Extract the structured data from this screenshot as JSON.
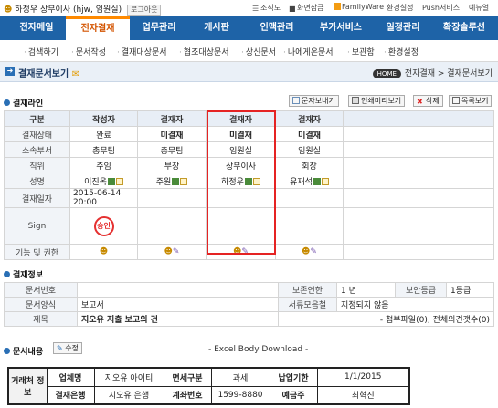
{
  "topbar": {
    "user_text": "하정우 상무이사 (hjw, 임원실)",
    "logout_label": "로그아웃",
    "util": [
      "조직도",
      "화면잠금",
      "FamilyWare",
      "환경설정",
      "Push서비스",
      "예뉴얼"
    ]
  },
  "nav": {
    "tabs": [
      "전자메일",
      "전자결재",
      "업무관리",
      "게시판",
      "인맥관리",
      "부가서비스",
      "일정관리",
      "확장솔루션"
    ],
    "active": "전자결재"
  },
  "subnav": [
    "검색하기",
    "문서작성",
    "결재대상문서",
    "협조대상문서",
    "상신문서",
    "나에게온문서",
    "보관함",
    "환경설정"
  ],
  "page": {
    "title": "결재문서보기",
    "home_label": "HOME",
    "breadcrumb": "전자결재 > 결재문서보기"
  },
  "approval": {
    "section_title": "결재라인",
    "buttons": [
      "문자보내기",
      "인쇄미리보기",
      "삭제",
      "목록보기"
    ],
    "columns": [
      "구분",
      "작성자",
      "결재자",
      "결재자",
      "결재자"
    ],
    "rows": [
      {
        "label": "결재상태",
        "cells": [
          "완료",
          "미결재",
          "미결재",
          "미결재"
        ]
      },
      {
        "label": "소속부서",
        "cells": [
          "총무팀",
          "총무팀",
          "임원실",
          "임원실"
        ]
      },
      {
        "label": "직위",
        "cells": [
          "주임",
          "부장",
          "상무이사",
          "회장"
        ]
      },
      {
        "label": "성명",
        "cells": [
          "이진옥",
          "주원",
          "하정우",
          "유재석"
        ]
      },
      {
        "label": "결재일자",
        "cells": [
          "2015-06-14 20:00",
          "",
          "",
          ""
        ]
      },
      {
        "label": "Sign",
        "cells": [
          "승인",
          "",
          "",
          ""
        ]
      },
      {
        "label": "기능 및 권한",
        "cells": [
          "",
          "",
          "",
          ""
        ]
      }
    ]
  },
  "info": {
    "section_title": "결재정보",
    "doc_number_label": "문서번호",
    "doc_number": "",
    "retention_label": "보존연한",
    "retention": "1 년",
    "security_label": "보안등급",
    "security": "1등급",
    "form_label": "문서양식",
    "form": "보고서",
    "folder_label": "서류모음철",
    "folder": "지정되지 않음",
    "subject_label": "제목",
    "subject": "지오유 지출 보고의 건",
    "attachments": "- 첨부파일(0), 전체의견갯수(0)"
  },
  "content": {
    "section_title": "문서내용",
    "edit_label": "수정",
    "download_label": "- Excel Body Download -"
  },
  "body_table": {
    "row_header": "거래처 정 보",
    "company_label": "업체명",
    "company": "지오유 아이티",
    "tax_label": "면세구분",
    "tax": "과세",
    "deadline_label": "납입기한",
    "deadline": "1/1/2015",
    "bank_label": "결재은행",
    "bank": "지오유 은행",
    "account_label": "계좌번호",
    "account": "1599-8880",
    "holder_label": "예금주",
    "holder": "최혁진"
  }
}
